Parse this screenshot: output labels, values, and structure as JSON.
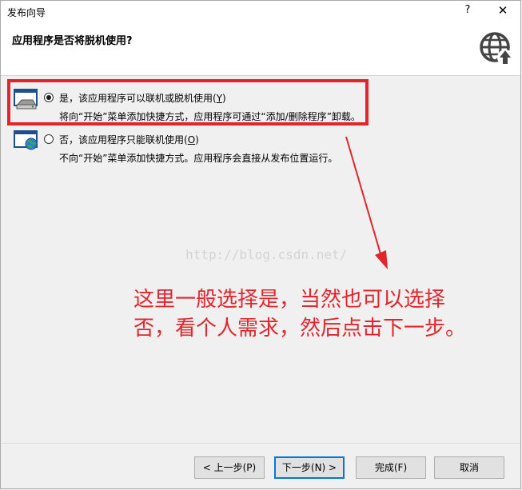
{
  "window": {
    "title": "发布向导",
    "help_glyph": "?",
    "close_glyph": "✕"
  },
  "header": {
    "heading": "应用程序是否将脱机使用?",
    "icon": "globe-upload-icon"
  },
  "options": {
    "offline": {
      "label": "是，该应用程序可以联机或脱机使用(",
      "mnemonic": "Y",
      "label_end": ")",
      "description": "将向“开始”菜单添加快捷方式，应用程序可通过“添加/删除程序”卸载。",
      "selected": true,
      "icon": "computer-drive-icon"
    },
    "online": {
      "label": "否，该应用程序只能联机使用(",
      "mnemonic": "O",
      "label_end": ")",
      "description": "不向“开始”菜单添加快捷方式。应用程序会直接从发布位置运行。",
      "selected": false,
      "icon": "computer-globe-icon"
    }
  },
  "overlay": {
    "watermark": "http://blog.csdn.net/",
    "annotation_line1": "这里一般选择是，当然也可以选择",
    "annotation_line2": "否，看个人需求，然后点击下一步。",
    "highlight_color": "#e0262c"
  },
  "buttons": {
    "back": "< 上一步(P)",
    "next": "下一步(N) >",
    "finish": "完成(F)",
    "cancel": "取消"
  }
}
